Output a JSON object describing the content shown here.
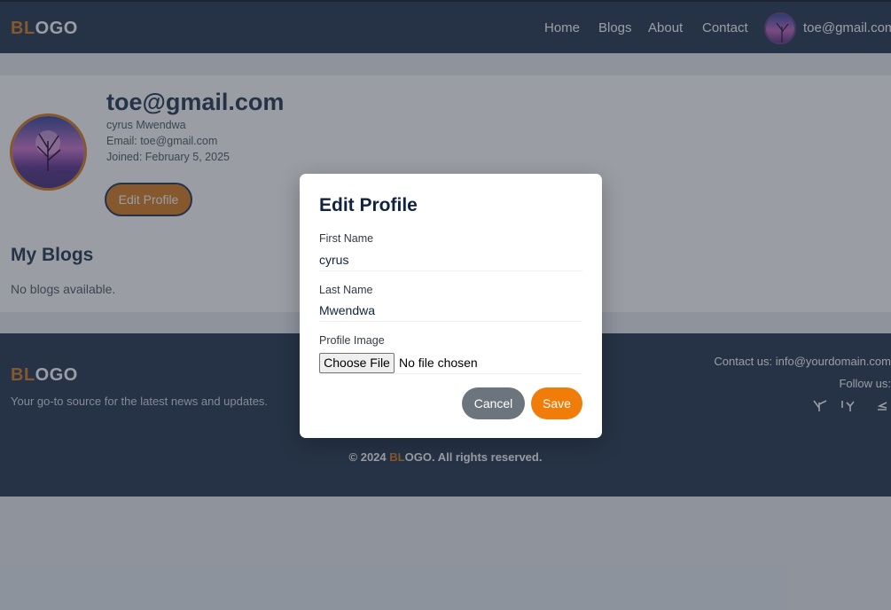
{
  "navbar": {
    "logo": {
      "part1": "BL",
      "part2": "OGO"
    },
    "links": [
      "Home",
      "Blogs",
      "About",
      "Contact"
    ],
    "user_email": "toe@gmail.com"
  },
  "profile": {
    "title": "toe@gmail.com",
    "full_name": "cyrus Mwendwa",
    "email_line": "Email: toe@gmail.com",
    "joined_line": "Joined: February 5, 2025",
    "edit_button": "Edit Profile"
  },
  "blogs": {
    "title": "My Blogs",
    "empty_message": "No blogs available."
  },
  "footer": {
    "logo": {
      "part1": "BL",
      "part2": "OGO"
    },
    "tagline": "Your go-to source for the latest news and updates.",
    "contact": "Contact us: info@yourdomain.com",
    "follow": "Follow us:",
    "copyright_prefix": "© 2024 ",
    "copyright_brand1": "BL",
    "copyright_brand2": "OGO",
    "copyright_suffix": ". All rights reserved."
  },
  "modal": {
    "title": "Edit Profile",
    "first_name_label": "First Name",
    "first_name_value": "cyrus",
    "last_name_label": "Last Name",
    "last_name_value": "Mwendwa",
    "image_label": "Profile Image",
    "file_button": "Choose File",
    "file_status": "No file chosen",
    "cancel": "Cancel",
    "save": "Save"
  },
  "colors": {
    "brand_accent": "#d9822b",
    "navbar_bg": "#2c3e57",
    "save_button": "#f07d0a",
    "cancel_button": "#6c757d"
  }
}
